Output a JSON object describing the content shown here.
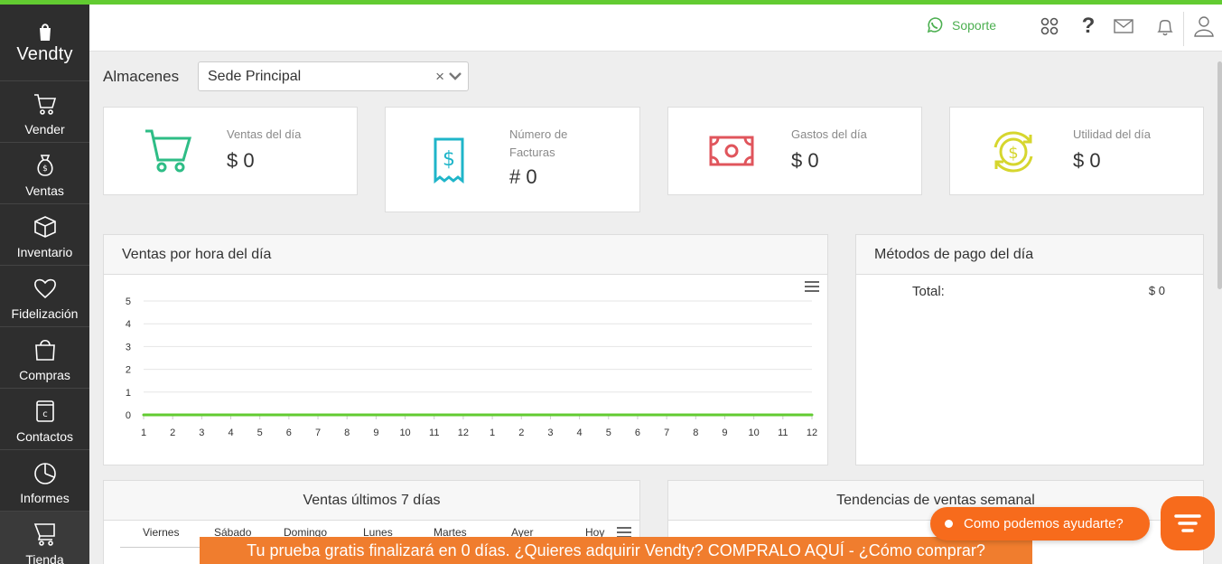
{
  "brand": {
    "name": "Vendty"
  },
  "sidebar": {
    "items": [
      {
        "label": "Vender",
        "icon": "cart-icon"
      },
      {
        "label": "Ventas",
        "icon": "money-bag-icon"
      },
      {
        "label": "Inventario",
        "icon": "box-icon"
      },
      {
        "label": "Fidelización",
        "icon": "heart-icon"
      },
      {
        "label": "Compras",
        "icon": "shopping-bag-icon"
      },
      {
        "label": "Contactos",
        "icon": "contact-book-icon"
      },
      {
        "label": "Informes",
        "icon": "pie-chart-icon"
      },
      {
        "label": "Tienda",
        "icon": "store-cart-icon"
      }
    ]
  },
  "header": {
    "support_label": "Soporte",
    "help_label": "?"
  },
  "warehouse": {
    "label": "Almacenes",
    "selected": "Sede Principal",
    "clear": "×"
  },
  "stats": [
    {
      "label": "Ventas del día",
      "value": "$ 0",
      "color": "#2ebd86"
    },
    {
      "label": "Número de Facturas",
      "value": "# 0",
      "color": "#1fb5c9"
    },
    {
      "label": "Gastos del día",
      "value": "$ 0",
      "color": "#e0555c"
    },
    {
      "label": "Utilidad del día",
      "value": "$ 0",
      "color": "#d6d62e"
    }
  ],
  "hourly_panel": {
    "title": "Ventas por hora del día"
  },
  "payments_panel": {
    "title": "Métodos de pago del día",
    "total_label": "Total:",
    "total_value": "$ 0"
  },
  "week_panel": {
    "title": "Ventas últimos 7 días",
    "days": [
      "Viernes",
      "Sábado",
      "Domingo",
      "Lunes",
      "Martes",
      "Ayer",
      "Hoy"
    ]
  },
  "trend_panel": {
    "title": "Tendencias de ventas semanal"
  },
  "trial_banner": "Tu prueba gratis finalizará en 0 días.  ¿Quieres adquirir Vendty? COMPRALO AQUÍ - ¿Cómo comprar?",
  "help_chat": {
    "label": "Como podemos ayudarte?"
  },
  "colors": {
    "accent": "#62cb31",
    "banner": "#f07d2e",
    "help": "#f76b1c"
  },
  "chart_data": {
    "type": "line",
    "title": "",
    "x": [
      "1",
      "2",
      "3",
      "4",
      "5",
      "6",
      "7",
      "8",
      "9",
      "10",
      "11",
      "12",
      "1",
      "2",
      "3",
      "4",
      "5",
      "6",
      "7",
      "8",
      "9",
      "10",
      "11",
      "12"
    ],
    "series": [
      {
        "values": [
          0,
          0,
          0,
          0,
          0,
          0,
          0,
          0,
          0,
          0,
          0,
          0,
          0,
          0,
          0,
          0,
          0,
          0,
          0,
          0,
          0,
          0,
          0,
          0
        ]
      }
    ],
    "ylim": [
      0,
      5
    ],
    "yticks": [
      0,
      1,
      2,
      3,
      4,
      5
    ],
    "grid": true,
    "line_color": "#62cb31"
  }
}
